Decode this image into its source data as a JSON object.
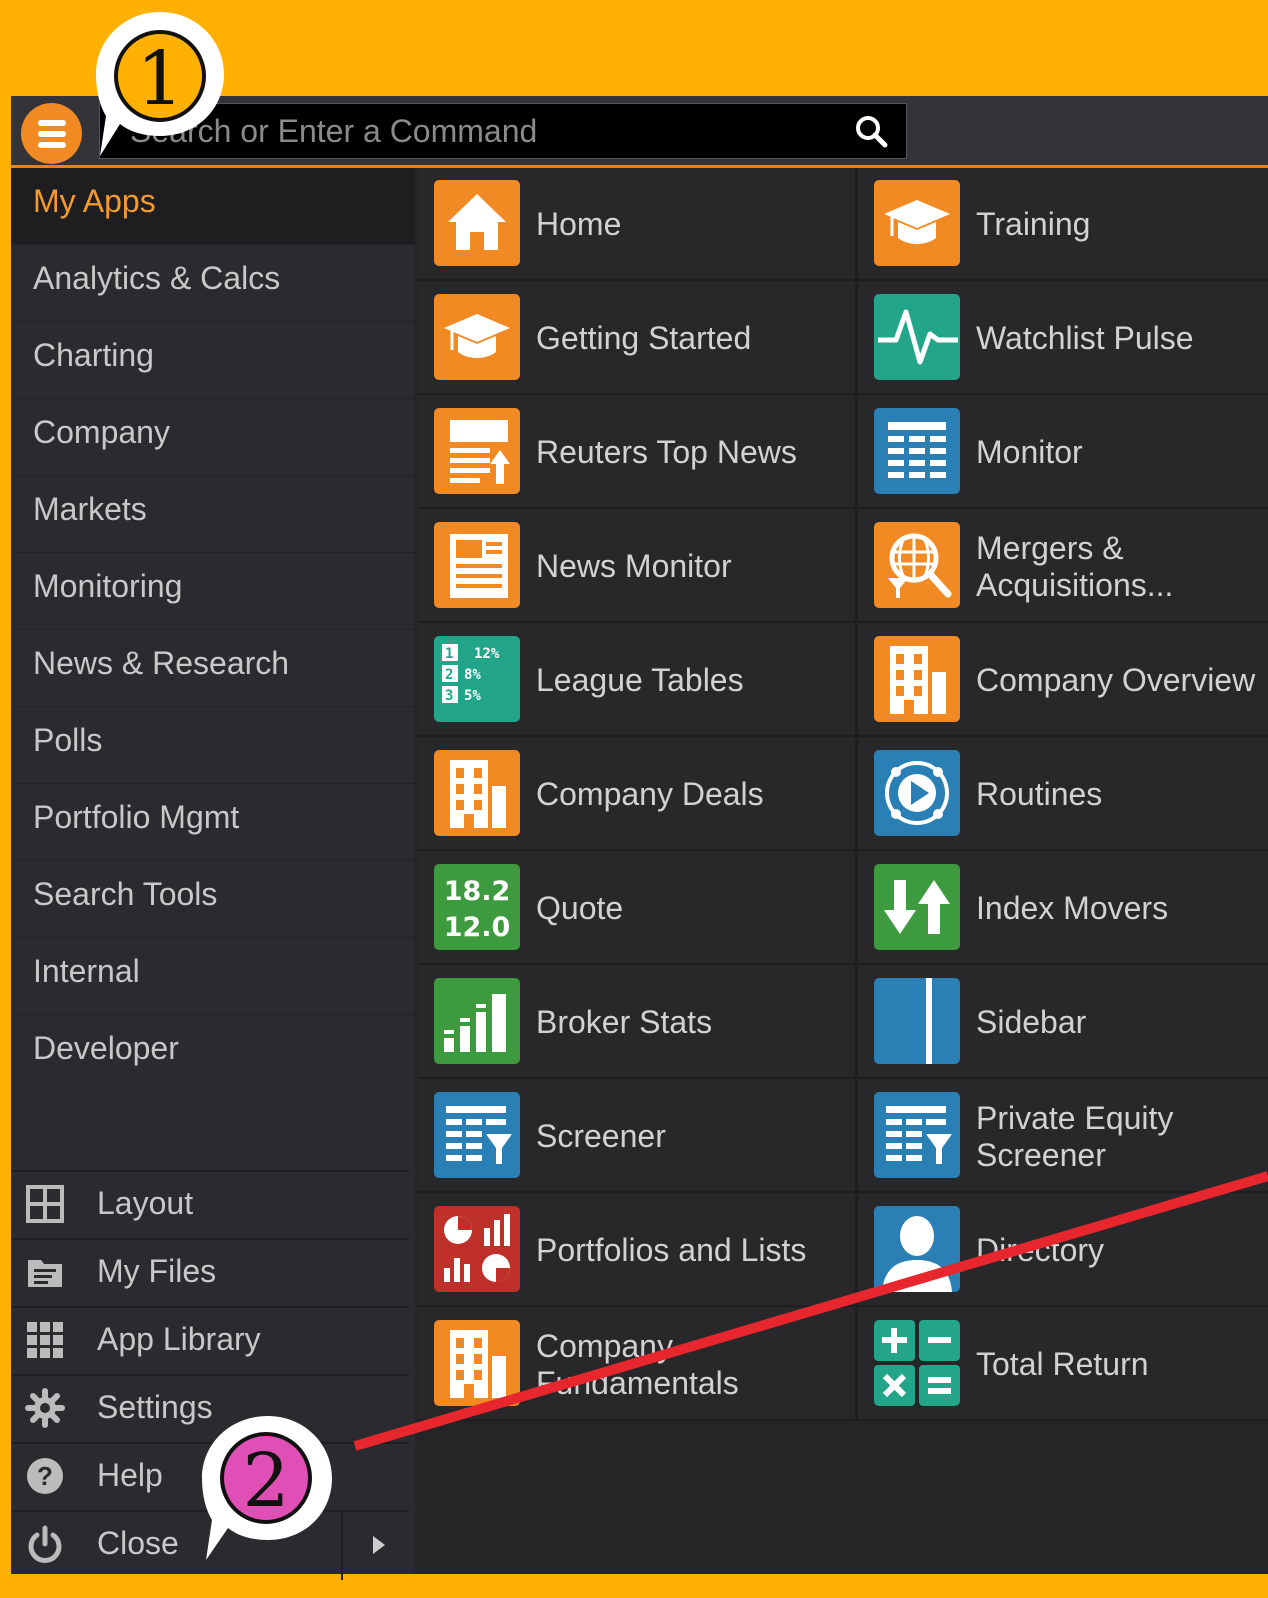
{
  "search": {
    "placeholder": "Search or Enter a Command"
  },
  "sidebar": {
    "categories": [
      "My Apps",
      "Analytics & Calcs",
      "Charting",
      "Company",
      "Markets",
      "Monitoring",
      "News & Research",
      "Polls",
      "Portfolio Mgmt",
      "Search Tools",
      "Internal",
      "Developer"
    ],
    "active": "My Apps",
    "utilities": [
      {
        "label": "Layout",
        "icon": "layout-icon"
      },
      {
        "label": "My Files",
        "icon": "folder-icon"
      },
      {
        "label": "App Library",
        "icon": "grid-icon"
      },
      {
        "label": "Settings",
        "icon": "gear-icon"
      },
      {
        "label": "Help",
        "icon": "help-icon"
      },
      {
        "label": "Close",
        "icon": "power-icon"
      }
    ]
  },
  "apps": [
    {
      "left": "Home",
      "right": "Training"
    },
    {
      "left": "Getting Started",
      "right": "Watchlist Pulse"
    },
    {
      "left": "Reuters Top News",
      "right": "Monitor"
    },
    {
      "left": "News Monitor",
      "right": "Mergers & Acquisitions..."
    },
    {
      "left": "League Tables",
      "right": "Company Overview"
    },
    {
      "left": "Company Deals",
      "right": "Routines"
    },
    {
      "left": "Quote",
      "right": "Index Movers"
    },
    {
      "left": "Broker Stats",
      "right": "Sidebar"
    },
    {
      "left": "Screener",
      "right": "Private Equity Screener"
    },
    {
      "left": "Portfolios and Lists",
      "right": "Directory"
    },
    {
      "left": "Company Fundamentals",
      "right": "Total Return"
    }
  ],
  "icon_text": {
    "league": [
      "1",
      "12%",
      "2",
      "8%",
      "3",
      "5%"
    ],
    "quote": [
      "18.2",
      "12.0"
    ]
  },
  "callouts": [
    "1",
    "2"
  ],
  "colors": {
    "background": "#FFB000",
    "accent": "#F28A24",
    "teal": "#23A58A",
    "blue": "#2A7FB5",
    "green": "#3E9A3E",
    "red": "#C0302B",
    "annotation_line": "#E8262E"
  }
}
